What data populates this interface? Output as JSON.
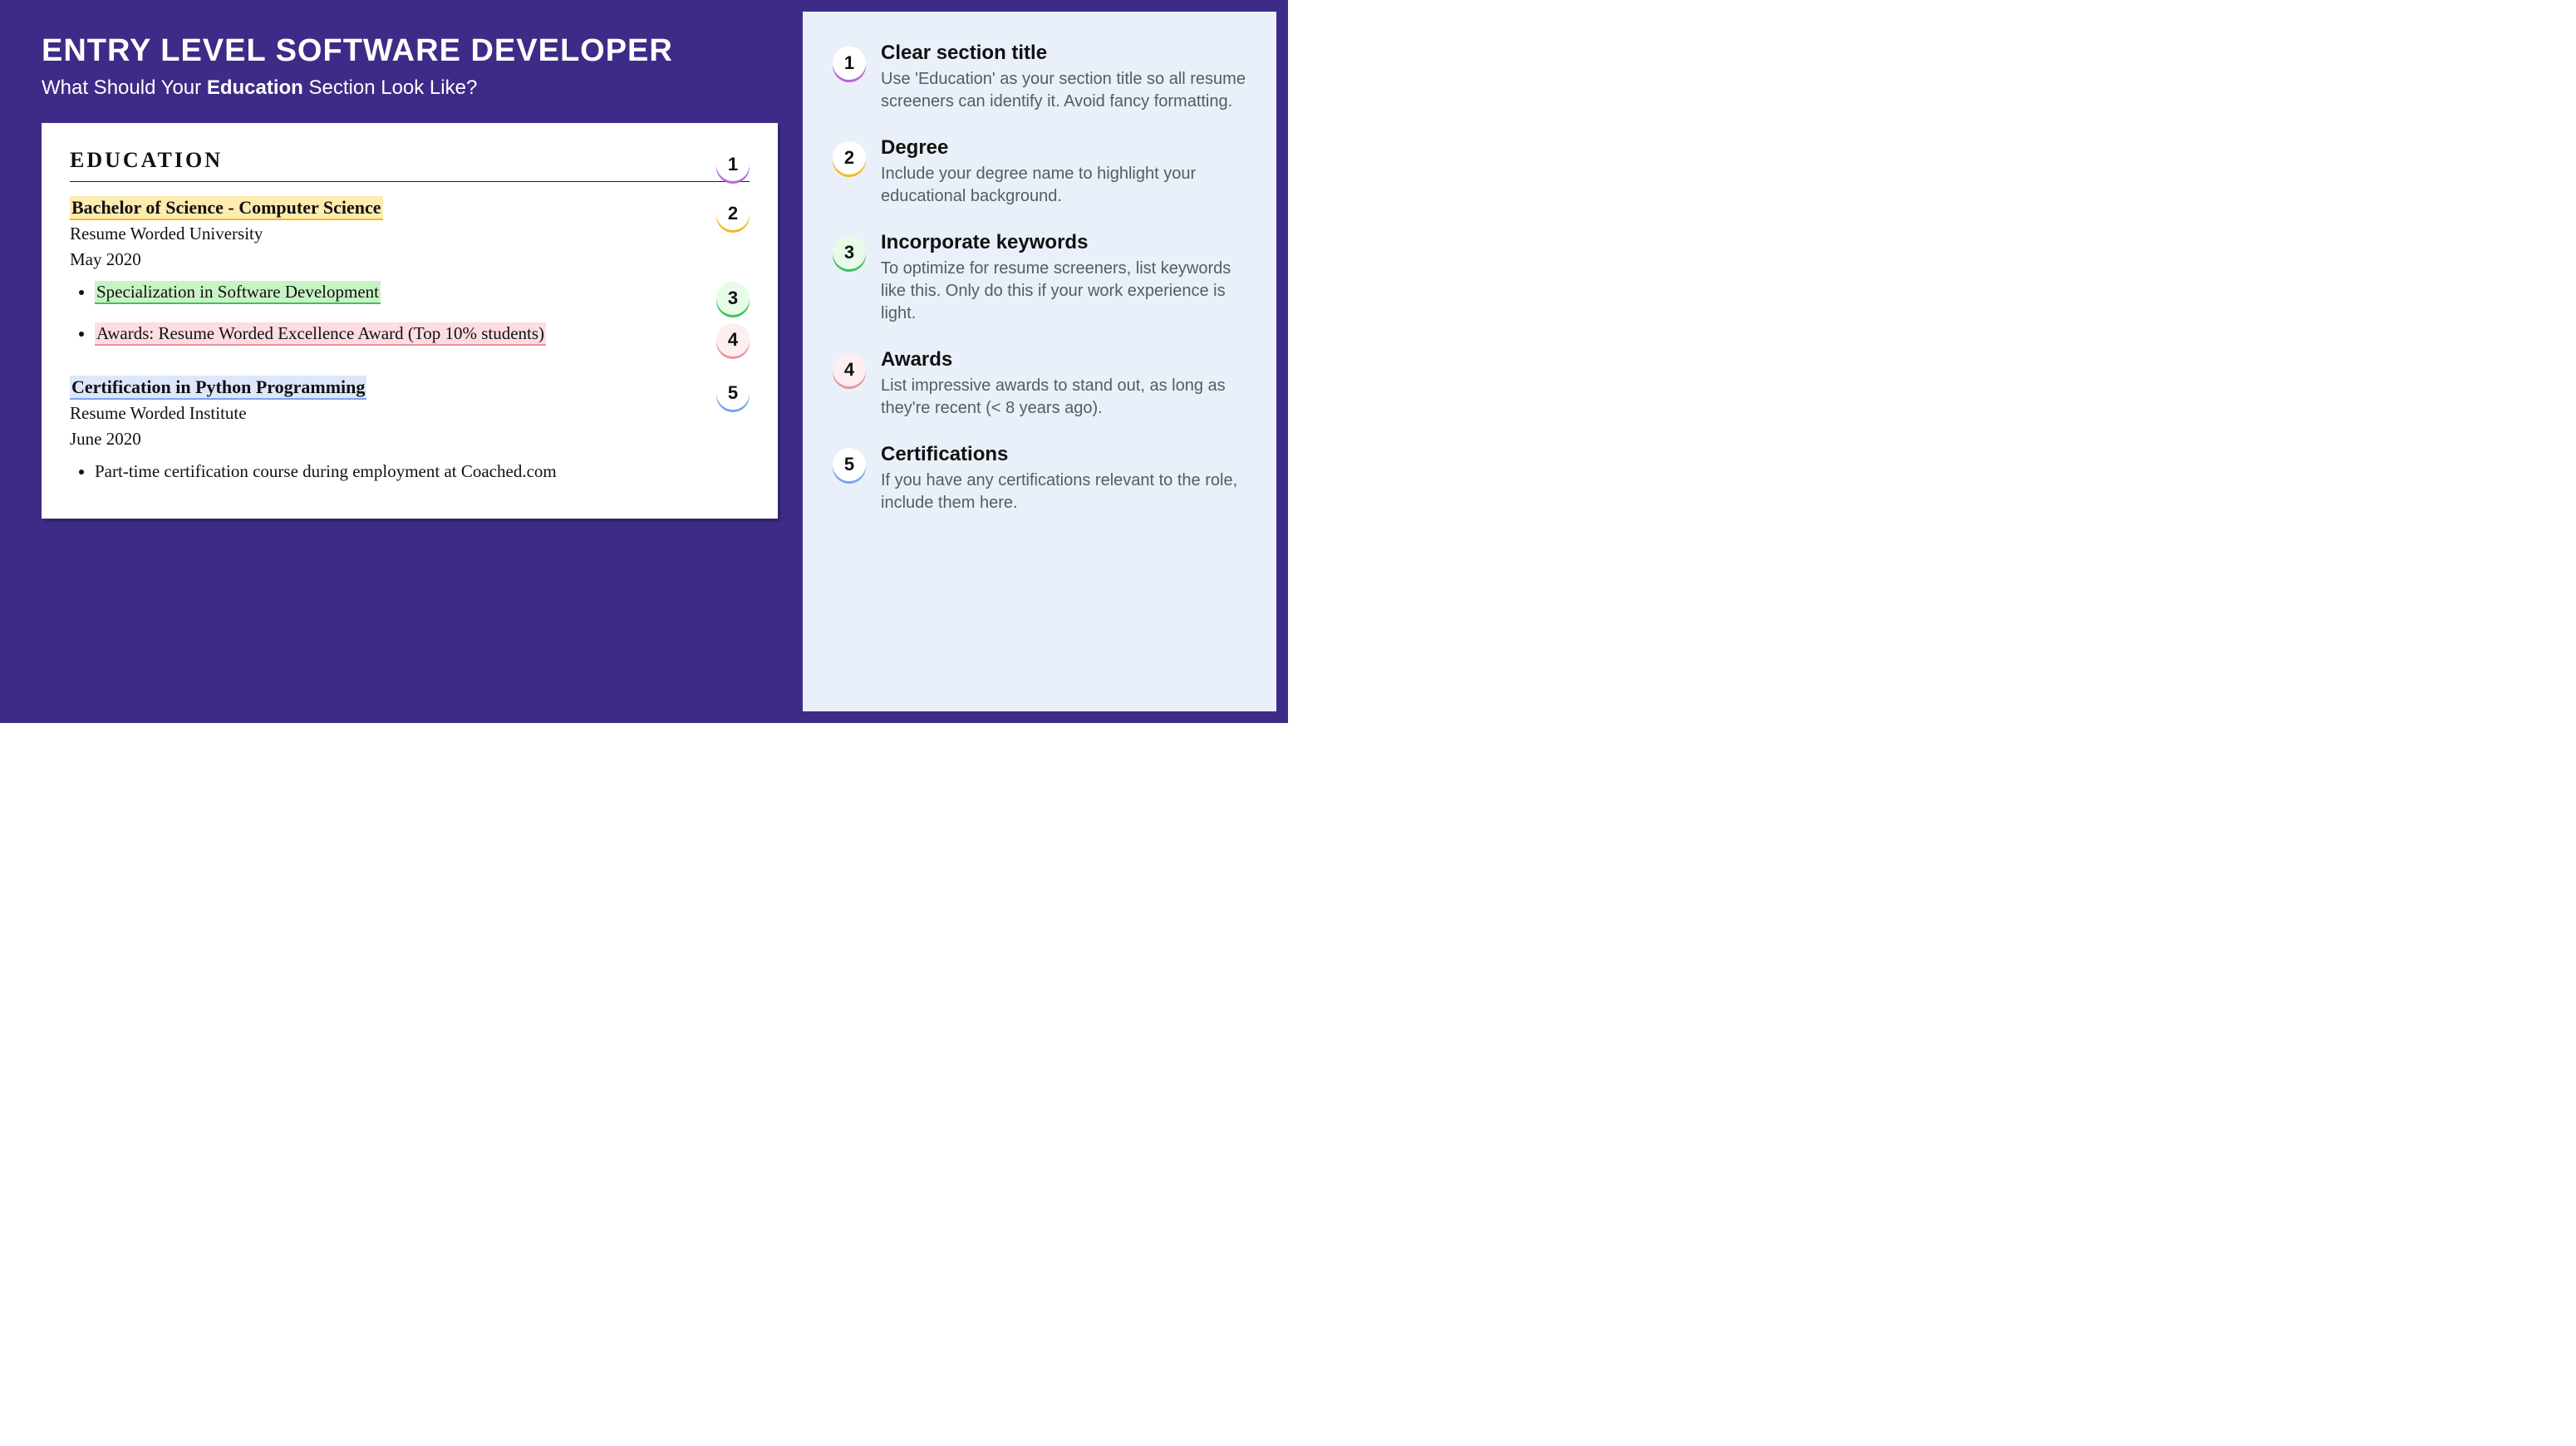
{
  "header": {
    "title": "ENTRY LEVEL SOFTWARE DEVELOPER",
    "subtitle_pre": "What Should Your ",
    "subtitle_bold": "Education",
    "subtitle_post": " Section Look Like?"
  },
  "resume": {
    "section_title": "EDUCATION",
    "degree": "Bachelor of Science - Computer Science",
    "degree_inst": "Resume Worded University",
    "degree_date": "May 2020",
    "bullet_spec": "Specialization in Software Development",
    "bullet_award": "Awards: Resume Worded Excellence Award (Top 10% students)",
    "cert": "Certification in Python Programming",
    "cert_inst": "Resume Worded Institute",
    "cert_date": "June 2020",
    "cert_bullet": "Part-time certification course during employment at Coached.com"
  },
  "badges": {
    "n1": "1",
    "n2": "2",
    "n3": "3",
    "n4": "4",
    "n5": "5"
  },
  "tips": [
    {
      "num": "1",
      "title": "Clear section title",
      "body": "Use 'Education' as your section title so all resume screeners can identify it. Avoid fancy formatting."
    },
    {
      "num": "2",
      "title": "Degree",
      "body": "Include your degree name to highlight your educational background."
    },
    {
      "num": "3",
      "title": "Incorporate keywords",
      "body": "To optimize for resume screeners, list keywords like this. Only do this if your work experience is light."
    },
    {
      "num": "4",
      "title": "Awards",
      "body": "List impressive awards to stand out, as long as they're recent (< 8 years ago)."
    },
    {
      "num": "5",
      "title": "Certifications",
      "body": "If you have any certifications relevant to the role, include them here."
    }
  ]
}
